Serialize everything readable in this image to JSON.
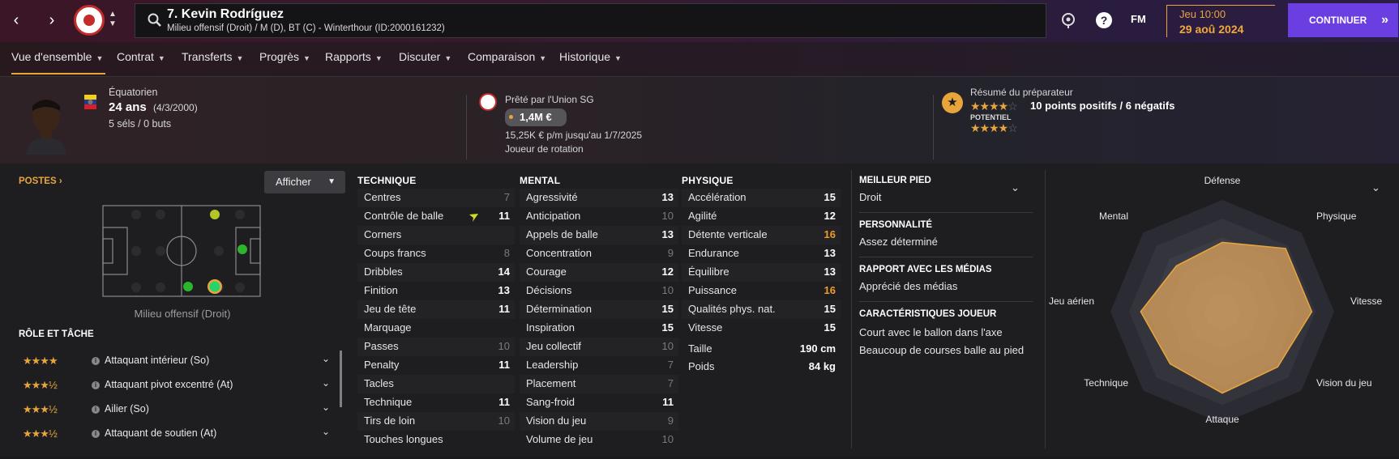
{
  "topbar": {
    "player_title": "7. Kevin Rodríguez",
    "player_sub": "Milieu offensif (Droit) / M (D), BT (C) - Winterthour (ID:2000161232)",
    "fm_label": "FM",
    "date_day": "Jeu 10:00",
    "date_full": "29 aoû 2024",
    "continue_label": "CONTINUER",
    "continue_arrow": "»"
  },
  "tabs": [
    {
      "label": "Vue d'ensemble"
    },
    {
      "label": "Contrat"
    },
    {
      "label": "Transferts"
    },
    {
      "label": "Progrès"
    },
    {
      "label": "Rapports"
    },
    {
      "label": "Discuter"
    },
    {
      "label": "Comparaison"
    },
    {
      "label": "Historique"
    }
  ],
  "profile": {
    "nationality": "Équatorien",
    "age": "24 ans",
    "birth": "(4/3/2000)",
    "caps": "5 séls / 0 buts",
    "loan_text": "Prêté par l'Union SG",
    "value": "1,4M €",
    "wage": "15,25K € p/m jusqu'au 1/7/2025",
    "squad_status": "Joueur de rotation",
    "scout_title": "Résumé du préparateur",
    "scout_summary": "10 points positifs / 6 négatifs",
    "potential_label": "POTENTIEL",
    "ability_stars": 4,
    "potential_stars": 4
  },
  "positions": {
    "title": "POSTES",
    "display_btn": "Afficher",
    "caption": "Milieu offensif (Droit)"
  },
  "roles": {
    "title": "RÔLE ET TÂCHE",
    "items": [
      {
        "stars": "★★★★",
        "name": "Attaquant intérieur (So)"
      },
      {
        "stars": "★★★½",
        "name": "Attaquant pivot excentré (At)"
      },
      {
        "stars": "★★★½",
        "name": "Ailier (So)"
      },
      {
        "stars": "★★★½",
        "name": "Attaquant de soutien (At)"
      }
    ]
  },
  "attributes": {
    "technical": {
      "title": "TECHNIQUE",
      "rows": [
        {
          "name": "Centres",
          "value": "7",
          "style": "dim"
        },
        {
          "name": "Contrôle de balle",
          "value": "11",
          "style": ""
        },
        {
          "name": "Corners",
          "value": "",
          "style": "dim"
        },
        {
          "name": "Coups francs",
          "value": "8",
          "style": "dim"
        },
        {
          "name": "Dribbles",
          "value": "14",
          "style": ""
        },
        {
          "name": "Finition",
          "value": "13",
          "style": ""
        },
        {
          "name": "Jeu de tête",
          "value": "11",
          "style": ""
        },
        {
          "name": "Marquage",
          "value": "",
          "style": "dim"
        },
        {
          "name": "Passes",
          "value": "10",
          "style": "dim"
        },
        {
          "name": "Penalty",
          "value": "11",
          "style": ""
        },
        {
          "name": "Tacles",
          "value": "",
          "style": "dim"
        },
        {
          "name": "Technique",
          "value": "11",
          "style": ""
        },
        {
          "name": "Tirs de loin",
          "value": "10",
          "style": "dim"
        },
        {
          "name": "Touches longues",
          "value": "",
          "style": "dim"
        }
      ]
    },
    "mental": {
      "title": "MENTAL",
      "rows": [
        {
          "name": "Agressivité",
          "value": "13",
          "style": ""
        },
        {
          "name": "Anticipation",
          "value": "10",
          "style": "dim"
        },
        {
          "name": "Appels de balle",
          "value": "13",
          "style": ""
        },
        {
          "name": "Concentration",
          "value": "9",
          "style": "dim"
        },
        {
          "name": "Courage",
          "value": "12",
          "style": ""
        },
        {
          "name": "Décisions",
          "value": "10",
          "style": "dim"
        },
        {
          "name": "Détermination",
          "value": "15",
          "style": ""
        },
        {
          "name": "Inspiration",
          "value": "15",
          "style": ""
        },
        {
          "name": "Jeu collectif",
          "value": "10",
          "style": "dim"
        },
        {
          "name": "Leadership",
          "value": "7",
          "style": "dim"
        },
        {
          "name": "Placement",
          "value": "7",
          "style": "dim"
        },
        {
          "name": "Sang-froid",
          "value": "11",
          "style": ""
        },
        {
          "name": "Vision du jeu",
          "value": "9",
          "style": "dim"
        },
        {
          "name": "Volume de jeu",
          "value": "10",
          "style": "dim"
        }
      ]
    },
    "physical": {
      "title": "PHYSIQUE",
      "rows": [
        {
          "name": "Accélération",
          "value": "15",
          "style": ""
        },
        {
          "name": "Agilité",
          "value": "12",
          "style": ""
        },
        {
          "name": "Détente verticale",
          "value": "16",
          "style": "hi"
        },
        {
          "name": "Endurance",
          "value": "13",
          "style": ""
        },
        {
          "name": "Équilibre",
          "value": "13",
          "style": ""
        },
        {
          "name": "Puissance",
          "value": "16",
          "style": "hi"
        },
        {
          "name": "Qualités phys. nat.",
          "value": "15",
          "style": ""
        },
        {
          "name": "Vitesse",
          "value": "15",
          "style": ""
        }
      ],
      "extra": [
        {
          "name": "Taille",
          "value": "190 cm"
        },
        {
          "name": "Poids",
          "value": "84 kg"
        }
      ]
    }
  },
  "info": {
    "foot_head": "MEILLEUR PIED",
    "foot_val": "Droit",
    "pers_head": "PERSONNALITÉ",
    "pers_val": "Assez déterminé",
    "media_head": "RAPPORT AVEC LES MÉDIAS",
    "media_val": "Apprécié des médias",
    "traits_head": "CARACTÉRISTIQUES JOUEUR",
    "traits": [
      "Court avec le ballon dans l'axe",
      "Beaucoup de courses balle au pied"
    ]
  },
  "radar": {
    "labels": [
      "Défense",
      "Physique",
      "Vitesse",
      "Vision du jeu",
      "Attaque",
      "Technique",
      "Jeu aérien",
      "Mental"
    ],
    "values": [
      0.62,
      0.8,
      0.8,
      0.7,
      0.73,
      0.66,
      0.73,
      0.58
    ],
    "fill": "#d9a05c"
  },
  "colors": {
    "accent": "#e8a53c",
    "continue_bg": "#6a3ee0"
  }
}
